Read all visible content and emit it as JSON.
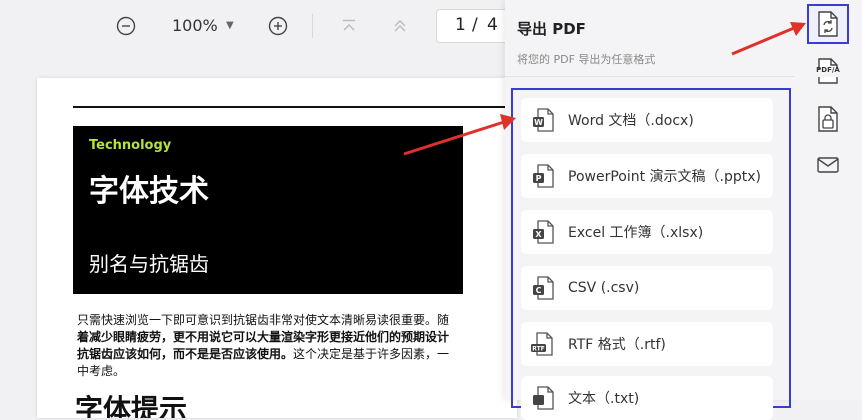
{
  "toolbar": {
    "zoom_value": "100%",
    "zoom_caret": "▼",
    "page_current": "1",
    "page_separator": "/",
    "page_total": "4"
  },
  "document": {
    "hero_tag": "Technology",
    "hero_title": "字体技术",
    "hero_subtitle": "别名与抗锯齿",
    "paragraph_lines": [
      "只需快速浏览一下即可意识到抗锯齿非常对使文本清晰易读很重要。随",
      "着减少眼睛疲劳，更不用说它可以大量渲染字形更接近他们的预期设计",
      "抗锯齿应该如何，而不是是否应该使用。这个决定是基于许多因素，一",
      "中考虑。"
    ],
    "paragraph_bold_line_3": "抗锯齿应该如何，而不是是否应该使用。",
    "paragraph_line_3_rest": "这个决定是基于许多因素，一",
    "heading2": "字体提示"
  },
  "export_panel": {
    "title": "导出 PDF",
    "subtitle": "将您的 PDF 导出为任意格式",
    "options": [
      {
        "label": "Word 文档（.docx)",
        "icon": "word-icon"
      },
      {
        "label": "PowerPoint 演示文稿（.pptx)",
        "icon": "powerpoint-icon"
      },
      {
        "label": "Excel 工作簿（.xlsx)",
        "icon": "excel-icon"
      },
      {
        "label": "CSV (.csv)",
        "icon": "csv-icon"
      },
      {
        "label": "RTF 格式（.rtf)",
        "icon": "rtf-icon"
      },
      {
        "label": "文本（.txt)",
        "icon": "text-file-icon"
      }
    ]
  },
  "rail": {
    "icons": [
      "export-convert-icon",
      "pdfa-icon",
      "lock-file-icon",
      "mail-icon"
    ],
    "pdfa_label": "PDF/A"
  },
  "colors": {
    "accent_frame": "#3b3ccf",
    "arrow_red": "#e0302a",
    "hero_tag": "#b6e23a"
  }
}
